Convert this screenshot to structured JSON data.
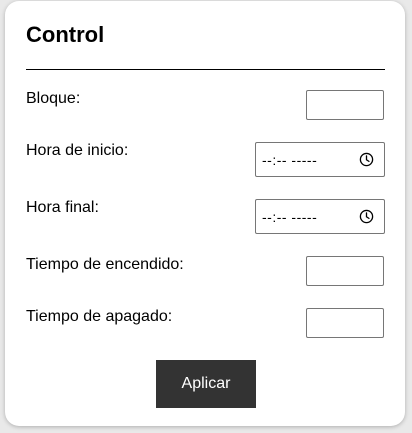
{
  "form": {
    "title": "Control",
    "fields": {
      "bloque": {
        "label": "Bloque:",
        "value": ""
      },
      "hora_inicio": {
        "label": "Hora de inicio:",
        "value": "--:-- -----"
      },
      "hora_final": {
        "label": "Hora final:",
        "value": "--:-- -----"
      },
      "tiempo_encendido": {
        "label": "Tiempo de encendido:",
        "value": ""
      },
      "tiempo_apagado": {
        "label": "Tiempo de apagado:",
        "value": ""
      }
    },
    "submit_label": "Aplicar"
  },
  "colors": {
    "button_bg": "#333333",
    "button_text": "#ffffff",
    "card_bg": "#ffffff",
    "page_bg": "#e9e9e9"
  },
  "icons": {
    "time_picker": "clock-icon"
  }
}
